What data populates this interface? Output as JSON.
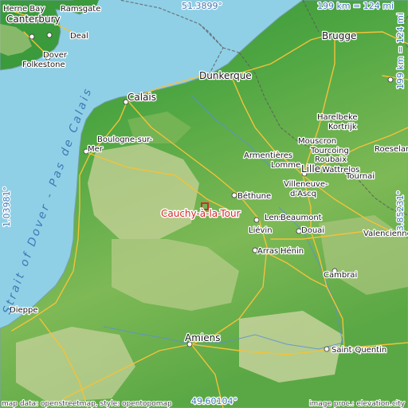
{
  "map": {
    "place": "Cauchy-à-la-Tour",
    "colors": {
      "sea": "#8fd0e6",
      "lowland": "#3a9a3e",
      "midland": "#6fb24a",
      "upland": "#b7c98a",
      "roads": "#f3c23a",
      "borders": "#5a5a5a",
      "target": "#d42a2a"
    },
    "coordinates": {
      "top": "51.3899°",
      "bottom": "49.60104°",
      "left": "1.03981°",
      "right": "3.85231°"
    },
    "scale": {
      "top": "199 km = 124 mi",
      "right": "199 km = 124 mi"
    },
    "sea_labels": {
      "channel": "Strait of Dover - Pas de Calais"
    },
    "cities": {
      "herne_bay": "Herne Bay",
      "ramsgate": "Ramsgate",
      "canterbury": "Canterbury",
      "deal": "Deal",
      "dover": "Dover",
      "folkestone": "Folkestone",
      "calais": "Calais",
      "dunkerque": "Dunkerque",
      "brugge": "Brugge",
      "harelbeke": "Harelbeke",
      "kortrijk": "Kortrijk",
      "boulogne1": "Boulogne-sur-",
      "boulogne2": "Mer",
      "armentieres": "Armentières",
      "mouscron": "Mouscron",
      "tourcoing": "Tourcoing",
      "roeselare": "Roeselare",
      "roubaix": "Roubaix",
      "lomme": "Lomme",
      "lille": "Lille",
      "wattrelos": "Wattrelos",
      "tournai": "Tournai",
      "villeneuve1": "Villeneuve-",
      "villeneuve2": "d'Ascq",
      "bethune": "Béthune",
      "lens": "Lens",
      "beaumont": "Beaumont",
      "lievin": "Liévin",
      "douai": "Douai",
      "valenciennes": "Valenciennes",
      "arras": "Arras",
      "henin": "Hénin",
      "cambrai": "Cambrai",
      "dieppe": "Dieppe",
      "amiens": "Amiens",
      "saint_quentin": "Saint-Quentin"
    },
    "credits": {
      "left": "map data: openstreetmap, style: opentopomap",
      "right": "image proc.: elevation.city"
    }
  }
}
